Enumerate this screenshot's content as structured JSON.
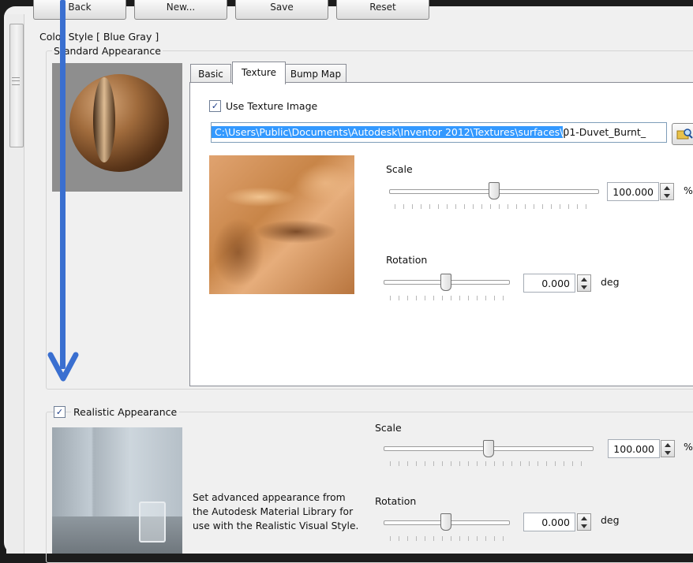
{
  "toolbar": {
    "back": "Back",
    "new": "New...",
    "save": "Save",
    "reset": "Reset"
  },
  "color_style_label": "Color Style [ Blue Gray ]",
  "standard": {
    "group_title": "Standard Appearance",
    "tabs": [
      "Basic",
      "Texture",
      "Bump Map"
    ],
    "active_tab": "Texture",
    "use_texture_label": "Use Texture Image",
    "use_texture_checked": true,
    "path_selected": "C:\\Users\\Public\\Documents\\Autodesk\\Inventor 2012\\Textures\\surfaces\\",
    "path_rest": "01-Duvet_Burnt_",
    "scale_label": "Scale",
    "scale_value": "100.000",
    "scale_unit": "%",
    "scale_slider": 0.5,
    "rotation_label": "Rotation",
    "rotation_value": "0.000",
    "rotation_unit": "deg",
    "rotation_slider": 0.5
  },
  "realistic": {
    "label": "Realistic Appearance",
    "checked": true,
    "description": "Set advanced appearance from the Autodesk Material Library for use with the Realistic Visual Style.",
    "scale_label": "Scale",
    "scale_value": "100.000",
    "scale_unit": "%",
    "rotation_label": "Rotation",
    "rotation_value": "0.000",
    "rotation_unit": "deg"
  },
  "colors": {
    "selection": "#3399ff",
    "annotation_arrow": "#3a6fd0"
  }
}
